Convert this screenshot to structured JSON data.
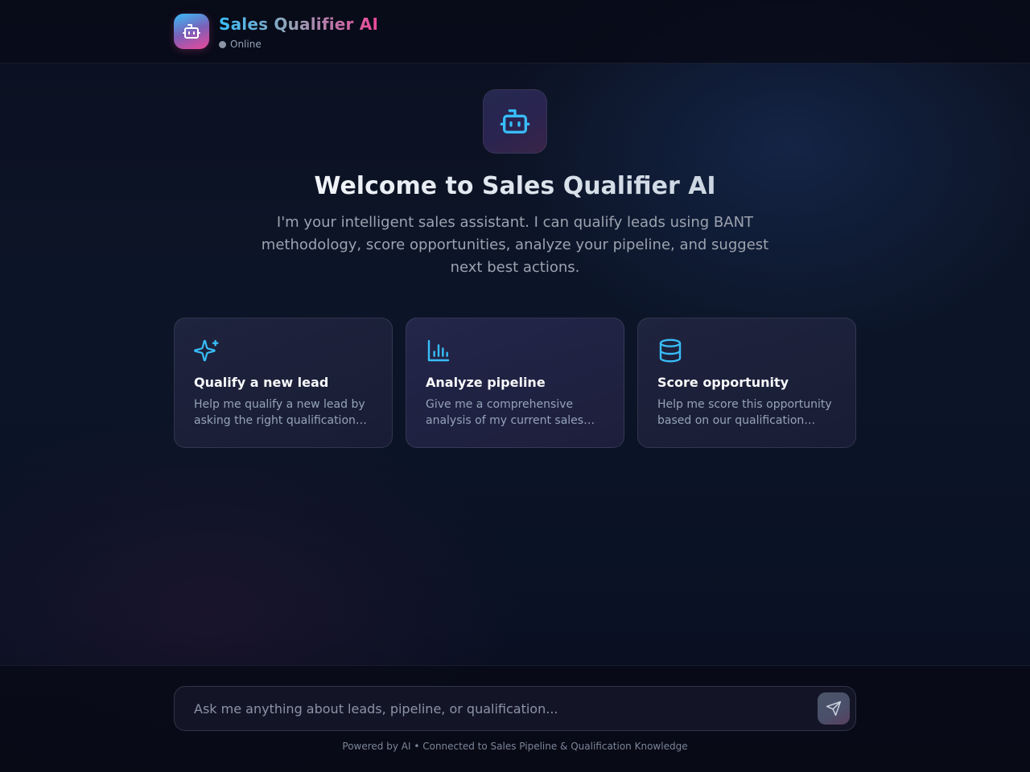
{
  "header": {
    "title": "Sales Qualifier AI",
    "status": "Online",
    "logo_icon": "robot-icon"
  },
  "hero": {
    "icon": "robot-icon",
    "title": "Welcome to Sales Qualifier AI",
    "subtitle": "I'm your intelligent sales assistant. I can qualify leads using BANT methodology, score opportunities, analyze your pipeline, and suggest next best actions."
  },
  "suggestions": [
    {
      "icon": "sparkles-icon",
      "title": "Qualify a new lead",
      "description": "Help me qualify a new lead by asking the right qualification questions using BANT methodology."
    },
    {
      "icon": "bar-chart-icon",
      "title": "Analyze pipeline",
      "description": "Give me a comprehensive analysis of my current sales pipeline and opportunities."
    },
    {
      "icon": "database-icon",
      "title": "Score opportunity",
      "description": "Help me score this opportunity based on our qualification criteria."
    }
  ],
  "composer": {
    "placeholder": "Ask me anything about leads, pipeline, or qualification...",
    "value": "",
    "send_icon": "send-icon"
  },
  "footer": {
    "note": "Powered by AI • Connected to Sales Pipeline & Qualification Knowledge"
  },
  "colors": {
    "accent_cyan": "#38bdf8",
    "accent_pink": "#ec4899",
    "background": "#0b1020"
  }
}
